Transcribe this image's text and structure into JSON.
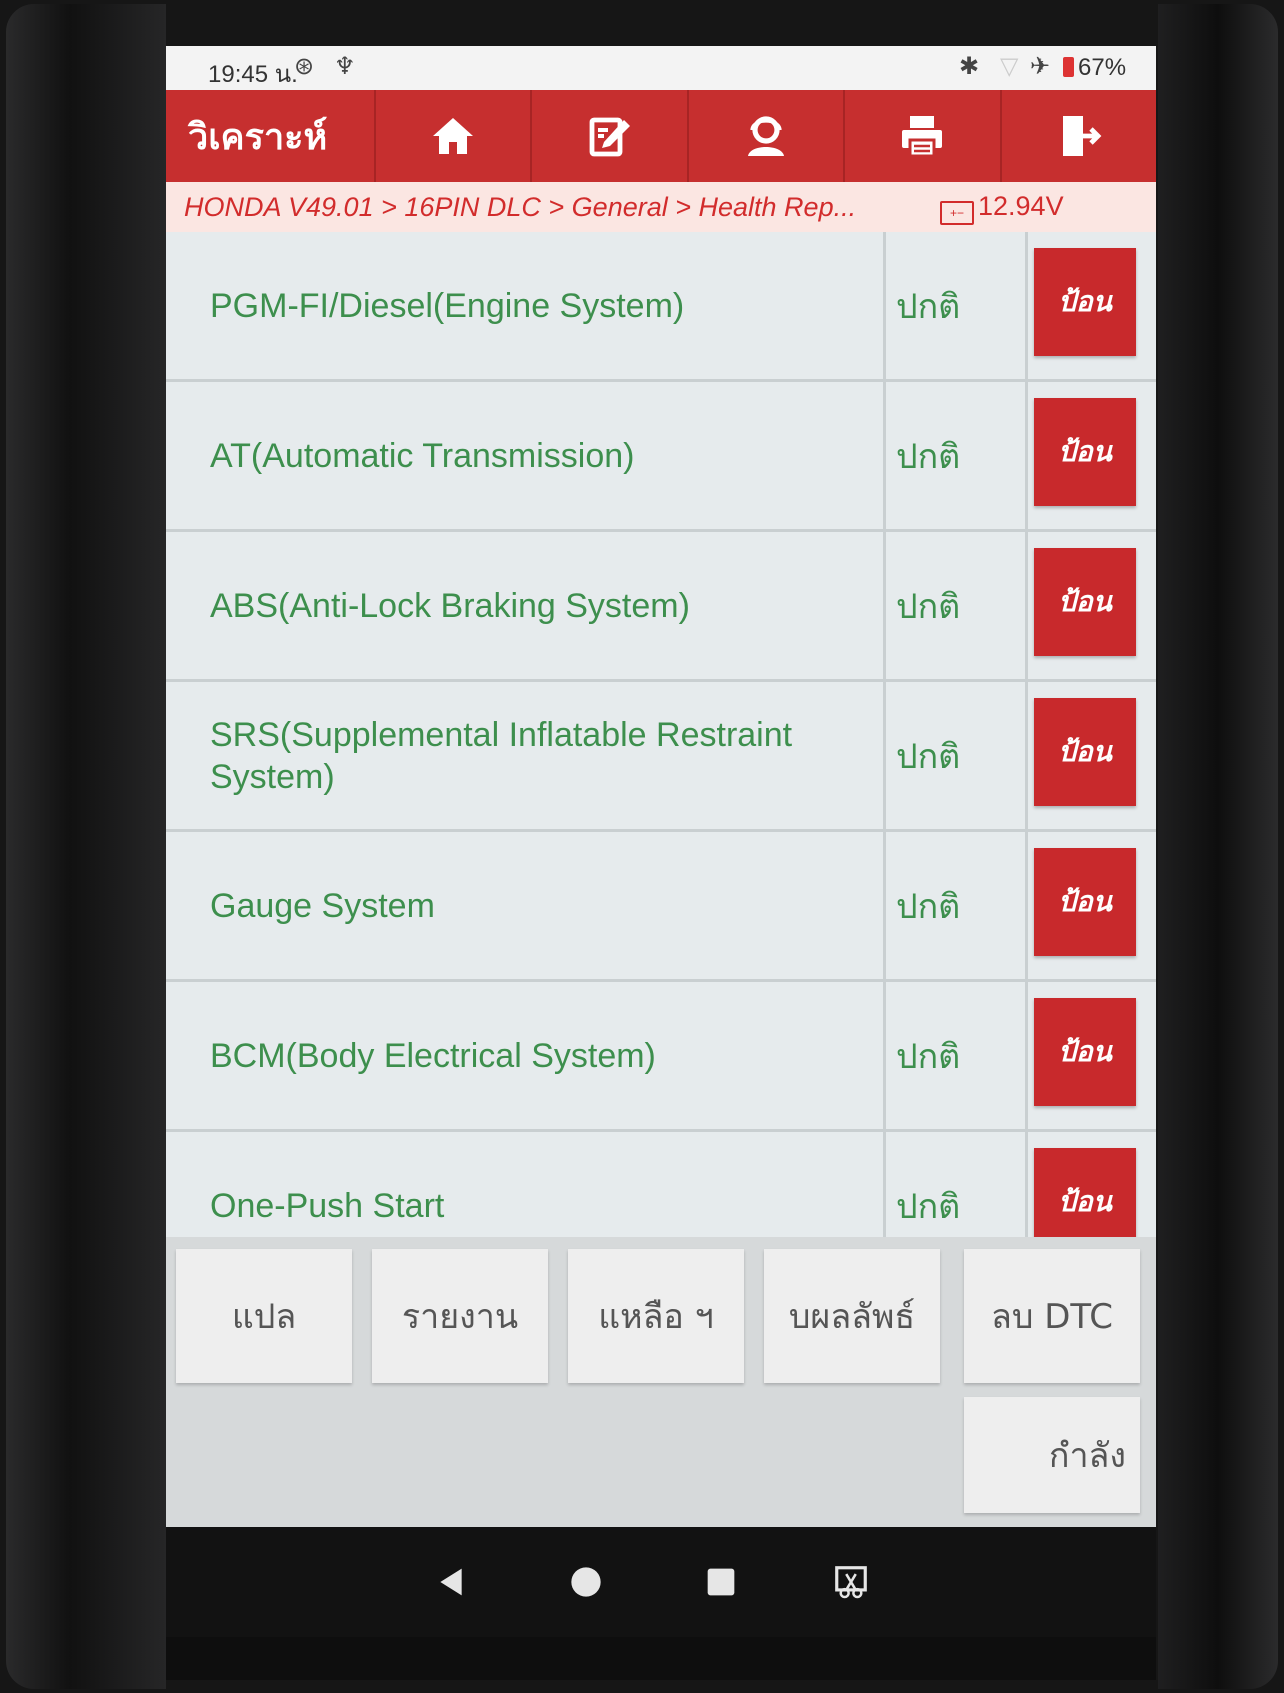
{
  "status_bar": {
    "time": "19:45 น.",
    "battery": "67%"
  },
  "toolbar": {
    "title": "วิเคราะห์",
    "buttons": [
      {
        "icon": "home-icon"
      },
      {
        "icon": "edit-icon"
      },
      {
        "icon": "support-icon"
      },
      {
        "icon": "print-icon"
      },
      {
        "icon": "exit-icon"
      }
    ]
  },
  "breadcrumb": {
    "path": "HONDA V49.01 > 16PIN DLC > General > Health Rep...",
    "voltage": "12.94V"
  },
  "systems": [
    {
      "name": "PGM-FI/Diesel(Engine System)",
      "status": "ปกติ",
      "action": "ป้อน"
    },
    {
      "name": "AT(Automatic Transmission)",
      "status": "ปกติ",
      "action": "ป้อน"
    },
    {
      "name": "ABS(Anti-Lock Braking System)",
      "status": "ปกติ",
      "action": "ป้อน"
    },
    {
      "name": "SRS(Supplemental Inflatable Restraint System)",
      "status": "ปกติ",
      "action": "ป้อน"
    },
    {
      "name": "Gauge System",
      "status": "ปกติ",
      "action": "ป้อน"
    },
    {
      "name": "BCM(Body Electrical System)",
      "status": "ปกติ",
      "action": "ป้อน"
    },
    {
      "name": "One-Push Start",
      "status": "ปกติ",
      "action": "ป้อน"
    }
  ],
  "bottom_buttons": [
    {
      "label": "แปล"
    },
    {
      "label": "รายงาน"
    },
    {
      "label": "แหลือ ฯ"
    },
    {
      "label": "บผลลัพธ์"
    },
    {
      "label": "ลบ DTC"
    }
  ],
  "bottom_button_2": {
    "label": "กำลัง"
  },
  "colors": {
    "toolbar": "#c62f2f",
    "breadcrumb_text": "#d22c2c",
    "system_text": "#3d8f4d",
    "action_button": "#c8292c"
  }
}
